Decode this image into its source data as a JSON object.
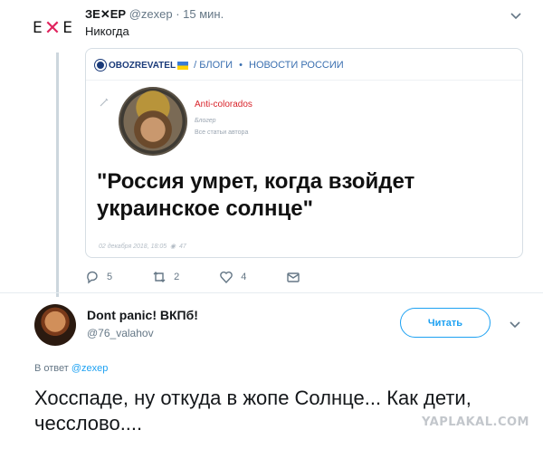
{
  "quoted_tweet": {
    "avatar_text": "EXE",
    "display_name": "ЗЕ✕ЕР",
    "handle": "@zexep",
    "time": "· 15 мин.",
    "text": "Никогда",
    "card": {
      "brand": "OBOZREVATEL",
      "breadcrumb_1": "БЛОГИ",
      "breadcrumb_sep": "•",
      "breadcrumb_2": "НОВОСТИ РОССИИ",
      "author_name": "Anti-colorados",
      "author_role": "Блогер",
      "author_all_articles": "Все статьи автора",
      "headline": "\"Россия умрет, когда взойдет украинское солнце\"",
      "date": "02 декабря 2018, 18:05",
      "views": "47"
    },
    "actions": {
      "replies": "5",
      "retweets": "2",
      "likes": "4"
    }
  },
  "reply_tweet": {
    "display_name": "Dont panic! ВКПб!",
    "handle": "@76_valahov",
    "follow_label": "Читать",
    "reply_to_prefix": "В ответ",
    "reply_to_handle": "@zexep",
    "text": "Хосспаде, ну откуда в жопе Солнце... Как дети, чесслово...."
  },
  "watermark": "YAPLAKAL.COM",
  "colors": {
    "accent": "#1da1f2",
    "brand_red": "#e0245e",
    "muted": "#657786"
  }
}
